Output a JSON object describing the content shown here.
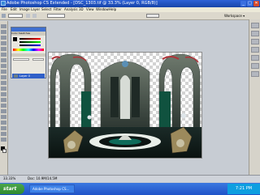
{
  "window": {
    "title": "Adobe Photoshop CS Extended - [DSC_1303.tif @ 33.3% (Layer 0, RGB/8)]",
    "minimize": "_",
    "maximize": "□",
    "close": "✕"
  },
  "menu": [
    "File",
    "Edit",
    "Image",
    "Layer",
    "Select",
    "Filter",
    "Analysis",
    "3D",
    "View",
    "Window",
    "Help"
  ],
  "options": {
    "workspace": "Workspace ▾"
  },
  "layers_panel": {
    "tabs": "Color  Swatches",
    "layer_name": "Layer 0"
  },
  "status": {
    "zoom": "33.33%",
    "doc": "Doc: 10.9M/14.5M"
  },
  "taskbar": {
    "start": "start",
    "task1": "Adobe Photoshop CS...",
    "clock": "7:21 PM"
  },
  "colors": {
    "titlebar": "#1f53c8",
    "canvas_bg": "#c7ccd3",
    "layer_selected": "#2f5fc8"
  }
}
